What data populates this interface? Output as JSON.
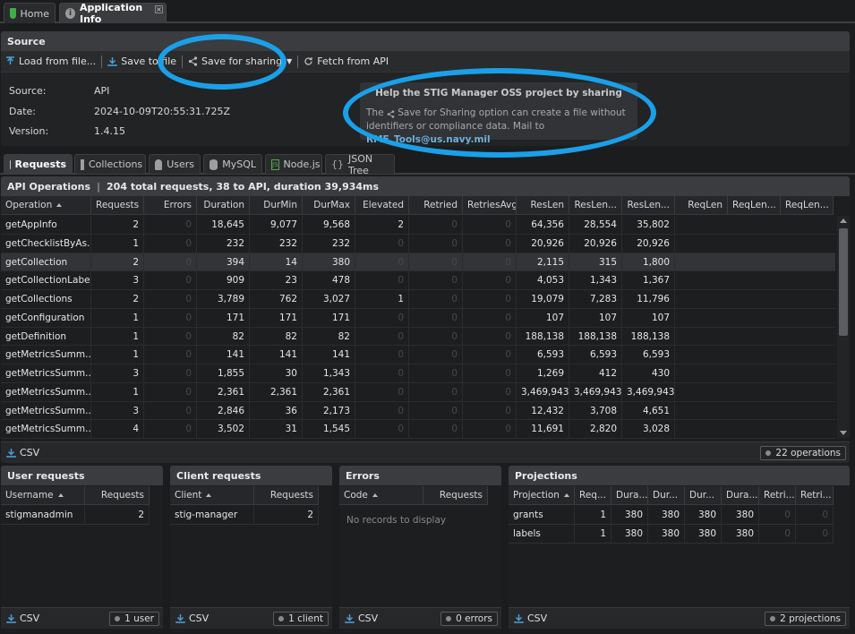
{
  "tabs": [
    {
      "label": "Home",
      "icon": "shield-check-icon"
    },
    {
      "label": "Application Info",
      "icon": "info-icon"
    }
  ],
  "source": {
    "title": "Source",
    "toolbar": {
      "load": "Load from file...",
      "save": "Save to file",
      "share": "Save for sharing",
      "fetch": "Fetch from API"
    },
    "fields": [
      {
        "label": "Source:",
        "value": "API"
      },
      {
        "label": "Date:",
        "value": "2024-10-09T20:55:31.725Z"
      },
      {
        "label": "Version:",
        "value": "1.4.15"
      }
    ],
    "help": {
      "title": "Help the STIG Manager OSS project by sharing",
      "body_pre": "The",
      "body_feature": "Save for Sharing",
      "body_mid": "option can create a file without identifiers or compliance data. Mail to",
      "email": "RMF_Tools@us.navy.mil"
    }
  },
  "detail_tabs": [
    "Requests",
    "Collections",
    "Users",
    "MySQL",
    "Node.js",
    "JSON Tree"
  ],
  "api": {
    "title": "API Operations",
    "summary": "204 total requests, 38 to API, duration 39,934ms",
    "columns": [
      "Operation",
      "Requests",
      "Errors",
      "Duration",
      "DurMin",
      "DurMax",
      "Elevated",
      "Retried",
      "RetriesAvg",
      "ResLen",
      "ResLen...",
      "ResLen...",
      "ReqLen",
      "ReqLen...",
      "ReqLen..."
    ],
    "rows": [
      [
        "getAppInfo",
        "2",
        "0",
        "18,645",
        "9,077",
        "9,568",
        "2",
        "0",
        "0",
        "64,356",
        "28,554",
        "35,802"
      ],
      [
        "getChecklistByAs...",
        "1",
        "0",
        "232",
        "232",
        "232",
        "0",
        "0",
        "0",
        "20,926",
        "20,926",
        "20,926"
      ],
      [
        "getCollection",
        "2",
        "0",
        "394",
        "14",
        "380",
        "0",
        "0",
        "0",
        "2,115",
        "315",
        "1,800"
      ],
      [
        "getCollectionLabels",
        "3",
        "0",
        "909",
        "23",
        "478",
        "0",
        "0",
        "0",
        "4,053",
        "1,343",
        "1,367"
      ],
      [
        "getCollections",
        "2",
        "0",
        "3,789",
        "762",
        "3,027",
        "1",
        "0",
        "0",
        "19,079",
        "7,283",
        "11,796"
      ],
      [
        "getConfiguration",
        "1",
        "0",
        "171",
        "171",
        "171",
        "0",
        "0",
        "0",
        "107",
        "107",
        "107"
      ],
      [
        "getDefinition",
        "1",
        "0",
        "82",
        "82",
        "82",
        "0",
        "0",
        "0",
        "188,138",
        "188,138",
        "188,138"
      ],
      [
        "getMetricsSumm...",
        "1",
        "0",
        "141",
        "141",
        "141",
        "0",
        "0",
        "0",
        "6,593",
        "6,593",
        "6,593"
      ],
      [
        "getMetricsSumm...",
        "3",
        "0",
        "1,855",
        "30",
        "1,343",
        "0",
        "0",
        "0",
        "1,269",
        "412",
        "430"
      ],
      [
        "getMetricsSumm...",
        "1",
        "0",
        "2,361",
        "2,361",
        "2,361",
        "0",
        "0",
        "0",
        "3,469,943",
        "3,469,943",
        "3,469,943"
      ],
      [
        "getMetricsSumm...",
        "3",
        "0",
        "2,846",
        "36",
        "2,173",
        "0",
        "0",
        "0",
        "12,432",
        "3,708",
        "4,651"
      ],
      [
        "getMetricsSumm...",
        "4",
        "0",
        "3,502",
        "31",
        "1,545",
        "0",
        "0",
        "0",
        "11,691",
        "2,820",
        "3,028"
      ]
    ],
    "csv": "CSV",
    "count": "22 operations"
  },
  "user_requests": {
    "title": "User requests",
    "columns": [
      "Username",
      "Requests"
    ],
    "rows": [
      [
        "stigmanadmin",
        "2"
      ]
    ],
    "csv": "CSV",
    "count": "1 user"
  },
  "client_requests": {
    "title": "Client requests",
    "columns": [
      "Client",
      "Requests"
    ],
    "rows": [
      [
        "stig-manager",
        "2"
      ]
    ],
    "csv": "CSV",
    "count": "1 client"
  },
  "errors": {
    "title": "Errors",
    "columns": [
      "Code",
      "Requests"
    ],
    "empty": "No records to display",
    "csv": "CSV",
    "count": "0 errors"
  },
  "projections": {
    "title": "Projections",
    "columns": [
      "Projection",
      "Req...",
      "Dura...",
      "Dur...",
      "Dur...",
      "Dura...",
      "Retri...",
      "Retri..."
    ],
    "rows": [
      [
        "grants",
        "1",
        "380",
        "380",
        "380",
        "380",
        "0",
        "0"
      ],
      [
        "labels",
        "1",
        "380",
        "380",
        "380",
        "380",
        "0",
        "0"
      ]
    ],
    "csv": "CSV",
    "count": "2 projections"
  },
  "colors": {
    "highlight_oval": "#1aa0e8",
    "link": "#6fb0d8",
    "home_icon": "#3fae49"
  }
}
